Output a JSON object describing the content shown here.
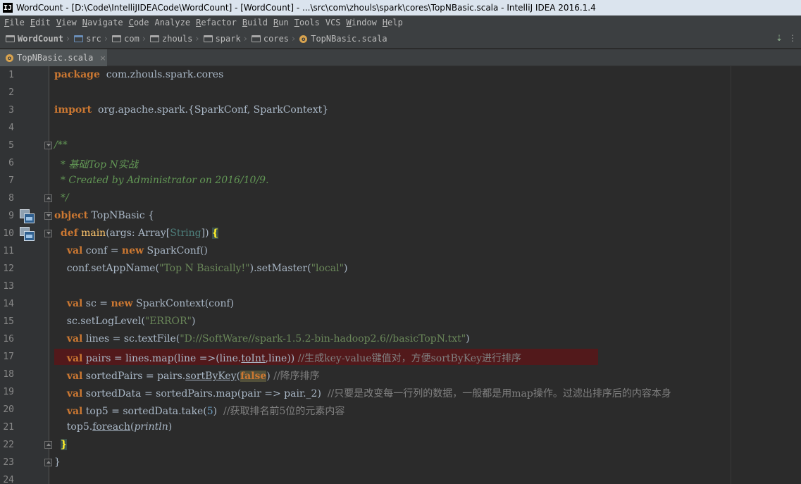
{
  "window": {
    "title": "WordCount - [D:\\Code\\IntelliJIDEACode\\WordCount] - [WordCount] - ...\\src\\com\\zhouls\\spark\\cores\\TopNBasic.scala - IntelliJ IDEA 2016.1.4",
    "app_icon": "IJ"
  },
  "menu": [
    {
      "u": "F",
      "rest": "ile"
    },
    {
      "u": "E",
      "rest": "dit"
    },
    {
      "u": "V",
      "rest": "iew"
    },
    {
      "u": "N",
      "rest": "avigate"
    },
    {
      "u": "C",
      "rest": "ode"
    },
    {
      "u": "",
      "rest": "Analyze"
    },
    {
      "u": "R",
      "rest": "efactor"
    },
    {
      "u": "B",
      "rest": "uild"
    },
    {
      "u": "R",
      "rest": "un"
    },
    {
      "u": "T",
      "rest": "ools"
    },
    {
      "u": "",
      "rest": "VCS"
    },
    {
      "u": "W",
      "rest": "indow"
    },
    {
      "u": "H",
      "rest": "elp"
    }
  ],
  "breadcrumbs": [
    {
      "label": "WordCount",
      "icon": "project-folder-icon"
    },
    {
      "label": "src",
      "icon": "source-folder-icon"
    },
    {
      "label": "com",
      "icon": "package-folder-icon"
    },
    {
      "label": "zhouls",
      "icon": "package-folder-icon"
    },
    {
      "label": "spark",
      "icon": "package-folder-icon"
    },
    {
      "label": "cores",
      "icon": "package-folder-icon"
    },
    {
      "label": "TopNBasic.scala",
      "icon": "scala-file-icon"
    }
  ],
  "tab": {
    "label": "TopNBasic.scala",
    "close": "×"
  },
  "editor": {
    "lines": [
      {
        "n": "1",
        "segs": [
          [
            "kw",
            "package"
          ],
          [
            "",
            "  com.zhouls.spark.cores"
          ]
        ]
      },
      {
        "n": "2",
        "segs": []
      },
      {
        "n": "3",
        "segs": [
          [
            "kw",
            "import"
          ],
          [
            "",
            "  org.apache.spark.{SparkConf, SparkContext}"
          ]
        ]
      },
      {
        "n": "4",
        "segs": []
      },
      {
        "n": "5",
        "segs": [
          [
            "doc",
            "/**"
          ]
        ]
      },
      {
        "n": "6",
        "segs": [
          [
            "doc",
            "  * 基础Top N实战"
          ]
        ]
      },
      {
        "n": "7",
        "segs": [
          [
            "doc",
            "  * Created by Administrator on 2016/10/9."
          ]
        ]
      },
      {
        "n": "8",
        "segs": [
          [
            "doc",
            "  */"
          ]
        ]
      },
      {
        "n": "9",
        "segs": [
          [
            "kw",
            "object"
          ],
          [
            "",
            " TopNBasic {"
          ]
        ]
      },
      {
        "n": "10",
        "segs": [
          [
            "",
            "  "
          ],
          [
            "kw",
            "def"
          ],
          [
            "",
            ""
          ],
          [
            "fn",
            " main"
          ],
          [
            "",
            "(args: Array["
          ],
          [
            "tparam",
            "String"
          ],
          [
            "",
            "]) "
          ],
          [
            "brace-hl",
            "{"
          ]
        ]
      },
      {
        "n": "11",
        "segs": [
          [
            "",
            "    "
          ],
          [
            "kw",
            "val"
          ],
          [
            "",
            " conf = "
          ],
          [
            "kw",
            "new"
          ],
          [
            "",
            " SparkConf()"
          ]
        ]
      },
      {
        "n": "12",
        "segs": [
          [
            "",
            "    conf.setAppName("
          ],
          [
            "str",
            "\"Top N Basically!\""
          ],
          [
            "",
            ").setMaster("
          ],
          [
            "str",
            "\"local\""
          ],
          [
            "",
            ")"
          ]
        ]
      },
      {
        "n": "13",
        "segs": []
      },
      {
        "n": "14",
        "segs": [
          [
            "",
            "    "
          ],
          [
            "kw",
            "val"
          ],
          [
            "",
            " sc = "
          ],
          [
            "kw",
            "new"
          ],
          [
            "",
            " SparkContext(conf)"
          ]
        ]
      },
      {
        "n": "15",
        "segs": [
          [
            "",
            "    sc.setLogLevel("
          ],
          [
            "str",
            "\"ERROR\""
          ],
          [
            "",
            ")"
          ]
        ]
      },
      {
        "n": "16",
        "segs": [
          [
            "",
            "    "
          ],
          [
            "kw",
            "val"
          ],
          [
            "",
            " lines = sc.textFile("
          ],
          [
            "str",
            "\"D://SoftWare//spark-1.5.2-bin-hadoop2.6//basicTopN.txt\""
          ],
          [
            "",
            ")"
          ]
        ]
      },
      {
        "n": "17",
        "segs": [
          [
            "",
            "    "
          ],
          [
            "kw",
            "val"
          ],
          [
            "",
            " pairs = lines.map(line =>(line."
          ],
          [
            "ul",
            "toInt"
          ],
          [
            "",
            ",line)) "
          ],
          [
            "cmt",
            "//生成key-value键值对，方便sortByKey进行排序"
          ]
        ],
        "error": true
      },
      {
        "n": "18",
        "segs": [
          [
            "",
            "    "
          ],
          [
            "kw",
            "val"
          ],
          [
            "",
            " sortedPairs = pairs."
          ],
          [
            "ul",
            "sortByKey"
          ],
          [
            "",
            "("
          ],
          [
            "false-hl",
            "false"
          ],
          [
            "",
            ") "
          ],
          [
            "cmt",
            "//降序排序"
          ]
        ]
      },
      {
        "n": "19",
        "segs": [
          [
            "",
            "    "
          ],
          [
            "kw",
            "val"
          ],
          [
            "",
            " sortedData = sortedPairs.map(pair => pair._2)  "
          ],
          [
            "cmt",
            "//只要是改变每一行列的数据，一般都是用map操作。过滤出排序后的内容本身"
          ]
        ]
      },
      {
        "n": "20",
        "segs": [
          [
            "",
            "    "
          ],
          [
            "kw",
            "val"
          ],
          [
            "",
            " top5 = sortedData.take("
          ],
          [
            "num",
            "5"
          ],
          [
            "",
            ")  "
          ],
          [
            "cmt",
            "//获取排名前5位的元素内容"
          ]
        ]
      },
      {
        "n": "21",
        "segs": [
          [
            "",
            "    top5."
          ],
          [
            "ul",
            "foreach"
          ],
          [
            "",
            "("
          ],
          [
            "ital",
            "println"
          ],
          [
            "",
            ")"
          ]
        ]
      },
      {
        "n": "22",
        "segs": [
          [
            "",
            "  "
          ],
          [
            "brace-hl",
            "}"
          ]
        ]
      },
      {
        "n": "23",
        "segs": [
          [
            "",
            "}"
          ]
        ]
      },
      {
        "n": "24",
        "segs": []
      }
    ]
  },
  "colors": {
    "background": "#2b2b2b",
    "keyword": "#cc7832",
    "string": "#6a8759",
    "comment": "#808080",
    "doc_comment": "#629755",
    "number": "#6897bb",
    "error_line": "#52191b"
  }
}
